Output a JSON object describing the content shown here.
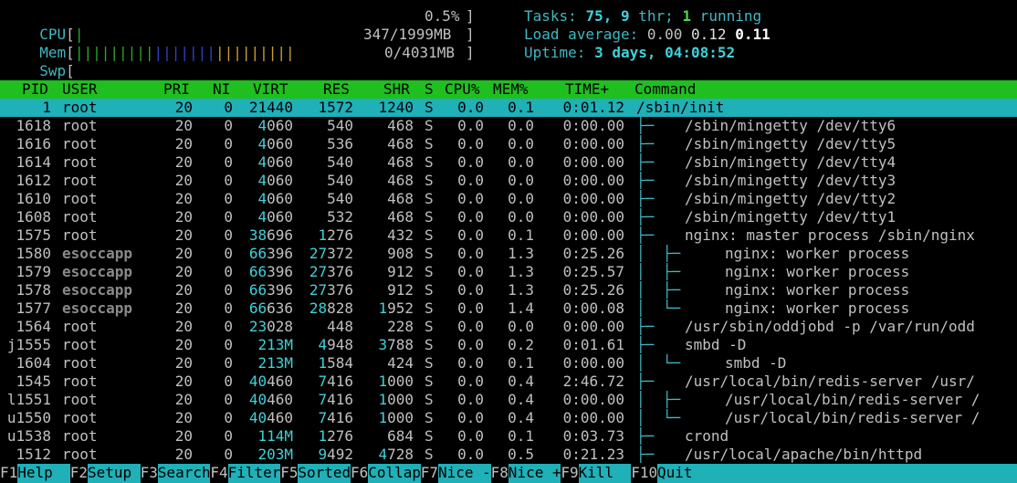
{
  "meters": {
    "cpu": {
      "label": "CPU",
      "value": "0.5%"
    },
    "mem": {
      "label": "Mem",
      "value": "347/1999MB"
    },
    "swp": {
      "label": "Swp",
      "value": "0/4031MB"
    }
  },
  "summary": {
    "tasks_label": "Tasks: ",
    "tasks": "75",
    "tasks_sep": ", ",
    "threads": "9",
    "thr_label": " thr; ",
    "running": "1",
    "running_label": " running",
    "load_label": "Load average: ",
    "load1": "0.00",
    "load5": "0.12",
    "load15": "0.11",
    "uptime_label": "Uptime: ",
    "uptime": "3 days, 04:08:52"
  },
  "columns": [
    "PID",
    "USER",
    "PRI",
    "NI",
    "VIRT",
    "RES",
    "SHR",
    "S",
    "CPU%",
    "MEM%",
    "TIME+",
    "Command"
  ],
  "processes": [
    {
      "pid": "1",
      "user": "root",
      "pri": "20",
      "ni": "0",
      "virt": "21440",
      "res": "1572",
      "shr": "1240",
      "s": "S",
      "cpu": "0.0",
      "mem": "0.1",
      "time": "0:01.12",
      "tree": "",
      "cmd": "/sbin/init"
    },
    {
      "pid": "1618",
      "user": "root",
      "pri": "20",
      "ni": "0",
      "virt": "4060",
      "res": "540",
      "shr": "468",
      "s": "S",
      "cpu": "0.0",
      "mem": "0.0",
      "time": "0:00.00",
      "tree": "├─",
      "cmd": "/sbin/mingetty /dev/tty6"
    },
    {
      "pid": "1616",
      "user": "root",
      "pri": "20",
      "ni": "0",
      "virt": "4060",
      "res": "536",
      "shr": "468",
      "s": "S",
      "cpu": "0.0",
      "mem": "0.0",
      "time": "0:00.00",
      "tree": "├─",
      "cmd": "/sbin/mingetty /dev/tty5"
    },
    {
      "pid": "1614",
      "user": "root",
      "pri": "20",
      "ni": "0",
      "virt": "4060",
      "res": "540",
      "shr": "468",
      "s": "S",
      "cpu": "0.0",
      "mem": "0.0",
      "time": "0:00.00",
      "tree": "├─",
      "cmd": "/sbin/mingetty /dev/tty4"
    },
    {
      "pid": "1612",
      "user": "root",
      "pri": "20",
      "ni": "0",
      "virt": "4060",
      "res": "540",
      "shr": "468",
      "s": "S",
      "cpu": "0.0",
      "mem": "0.0",
      "time": "0:00.00",
      "tree": "├─",
      "cmd": "/sbin/mingetty /dev/tty3"
    },
    {
      "pid": "1610",
      "user": "root",
      "pri": "20",
      "ni": "0",
      "virt": "4060",
      "res": "540",
      "shr": "468",
      "s": "S",
      "cpu": "0.0",
      "mem": "0.0",
      "time": "0:00.00",
      "tree": "├─",
      "cmd": "/sbin/mingetty /dev/tty2"
    },
    {
      "pid": "1608",
      "user": "root",
      "pri": "20",
      "ni": "0",
      "virt": "4060",
      "res": "532",
      "shr": "468",
      "s": "S",
      "cpu": "0.0",
      "mem": "0.0",
      "time": "0:00.00",
      "tree": "├─",
      "cmd": "/sbin/mingetty /dev/tty1"
    },
    {
      "pid": "1575",
      "user": "root",
      "pri": "20",
      "ni": "0",
      "virt": "38696",
      "res": "1276",
      "shr": "432",
      "s": "S",
      "cpu": "0.0",
      "mem": "0.1",
      "time": "0:00.00",
      "tree": "├─",
      "cmd": "nginx: master process /sbin/nginx"
    },
    {
      "pid": "1580",
      "user": "esoccapp",
      "pri": "20",
      "ni": "0",
      "virt": "66396",
      "res": "27372",
      "shr": "908",
      "s": "S",
      "cpu": "0.0",
      "mem": "1.3",
      "time": "0:25.26",
      "tree": "│  ├─",
      "cmd": "nginx: worker process"
    },
    {
      "pid": "1579",
      "user": "esoccapp",
      "pri": "20",
      "ni": "0",
      "virt": "66396",
      "res": "27376",
      "shr": "912",
      "s": "S",
      "cpu": "0.0",
      "mem": "1.3",
      "time": "0:25.57",
      "tree": "│  ├─",
      "cmd": "nginx: worker process"
    },
    {
      "pid": "1578",
      "user": "esoccapp",
      "pri": "20",
      "ni": "0",
      "virt": "66396",
      "res": "27376",
      "shr": "912",
      "s": "S",
      "cpu": "0.0",
      "mem": "1.3",
      "time": "0:25.26",
      "tree": "│  ├─",
      "cmd": "nginx: worker process"
    },
    {
      "pid": "1577",
      "user": "esoccapp",
      "pri": "20",
      "ni": "0",
      "virt": "66636",
      "res": "28828",
      "shr": "1952",
      "s": "S",
      "cpu": "0.0",
      "mem": "1.4",
      "time": "0:00.08",
      "tree": "│  └─",
      "cmd": "nginx: worker process"
    },
    {
      "pid": "1564",
      "user": "root",
      "pri": "20",
      "ni": "0",
      "virt": "23028",
      "res": "448",
      "shr": "228",
      "s": "S",
      "cpu": "0.0",
      "mem": "0.0",
      "time": "0:00.00",
      "tree": "├─",
      "cmd": "/usr/sbin/oddjobd -p /var/run/odd"
    },
    {
      "pid": "j1555",
      "user": "root",
      "pri": "20",
      "ni": "0",
      "virt": "213M",
      "res": "4948",
      "shr": "3788",
      "s": "S",
      "cpu": "0.0",
      "mem": "0.2",
      "time": "0:01.61",
      "tree": "├─",
      "cmd": "smbd -D"
    },
    {
      "pid": "1604",
      "user": "root",
      "pri": "20",
      "ni": "0",
      "virt": "213M",
      "res": "1584",
      "shr": "424",
      "s": "S",
      "cpu": "0.0",
      "mem": "0.1",
      "time": "0:00.00",
      "tree": "│  └─",
      "cmd": "smbd -D"
    },
    {
      "pid": "1545",
      "user": "root",
      "pri": "20",
      "ni": "0",
      "virt": "40460",
      "res": "7416",
      "shr": "1000",
      "s": "S",
      "cpu": "0.0",
      "mem": "0.4",
      "time": "2:46.72",
      "tree": "├─",
      "cmd": "/usr/local/bin/redis-server /usr/"
    },
    {
      "pid": "l1551",
      "user": "root",
      "pri": "20",
      "ni": "0",
      "virt": "40460",
      "res": "7416",
      "shr": "1000",
      "s": "S",
      "cpu": "0.0",
      "mem": "0.4",
      "time": "0:00.00",
      "tree": "│  ├─",
      "cmd": "/usr/local/bin/redis-server /"
    },
    {
      "pid": "u1550",
      "user": "root",
      "pri": "20",
      "ni": "0",
      "virt": "40460",
      "res": "7416",
      "shr": "1000",
      "s": "S",
      "cpu": "0.0",
      "mem": "0.4",
      "time": "0:00.00",
      "tree": "│  └─",
      "cmd": "/usr/local/bin/redis-server /"
    },
    {
      "pid": "u1538",
      "user": "root",
      "pri": "20",
      "ni": "0",
      "virt": "114M",
      "res": "1276",
      "shr": "684",
      "s": "S",
      "cpu": "0.0",
      "mem": "0.1",
      "time": "0:03.73",
      "tree": "├─",
      "cmd": "crond"
    },
    {
      "pid": "1512",
      "user": "root",
      "pri": "20",
      "ni": "0",
      "virt": "203M",
      "res": "9492",
      "shr": "4728",
      "s": "S",
      "cpu": "0.0",
      "mem": "0.5",
      "time": "0:21.23",
      "tree": "├─",
      "cmd": "/usr/local/apache/bin/httpd"
    }
  ],
  "footer": [
    {
      "key": "F1",
      "label": "Help  "
    },
    {
      "key": "F2",
      "label": "Setup "
    },
    {
      "key": "F3",
      "label": "Search"
    },
    {
      "key": "F4",
      "label": "Filter"
    },
    {
      "key": "F5",
      "label": "Sorted"
    },
    {
      "key": "F6",
      "label": "Collap"
    },
    {
      "key": "F7",
      "label": "Nice -"
    },
    {
      "key": "F8",
      "label": "Nice +"
    },
    {
      "key": "F9",
      "label": "Kill  "
    },
    {
      "key": "F10",
      "label": "Quit"
    }
  ],
  "colors": {
    "header_bg": "#1fbf1f",
    "selected_bg": "#1fb0b8",
    "accent": "#3fd1d9"
  }
}
